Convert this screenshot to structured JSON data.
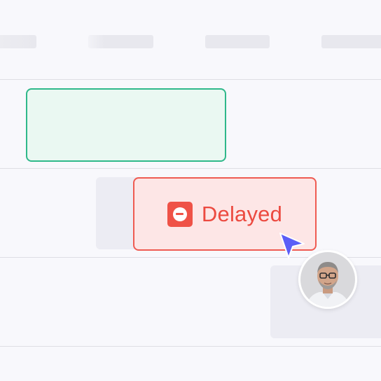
{
  "timeline": {
    "header_placeholders": [
      "skeleton",
      "skeleton",
      "skeleton",
      "skeleton"
    ]
  },
  "tasks": {
    "planned": {
      "status_color": "#2fb88a",
      "fill_color": "#eaf8f2"
    },
    "delayed": {
      "label": "Delayed",
      "status_icon": "minus-circle-icon",
      "status_color": "#ef5b52",
      "fill_color": "#fde6e6"
    }
  },
  "collaborator": {
    "cursor_icon": "pointer-arrow-icon",
    "cursor_color": "#5b5ef7",
    "avatar": "user-avatar-photo"
  }
}
